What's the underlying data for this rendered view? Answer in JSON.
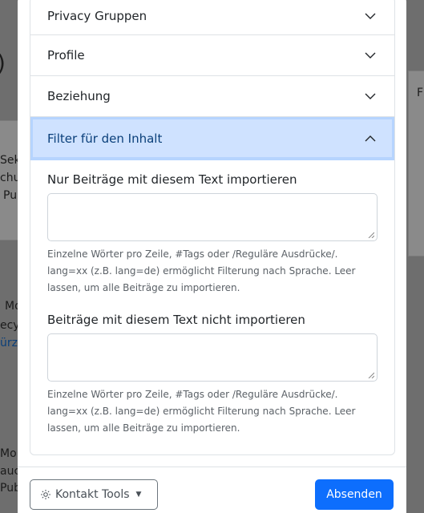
{
  "background": {
    "fragments": [
      "Sek",
      "chu",
      "Pub",
      "Mo",
      "ecy",
      "ürz",
      "Mo",
      "auc",
      "Pub",
      "F"
    ]
  },
  "accordion": {
    "items": [
      {
        "label": "Privacy Gruppen",
        "state": "collapsed"
      },
      {
        "label": "Profile",
        "state": "collapsed"
      },
      {
        "label": "Beziehung",
        "state": "collapsed"
      },
      {
        "label": "Filter für den Inhalt",
        "state": "expanded"
      }
    ]
  },
  "filter": {
    "include_label": "Nur Beiträge mit diesem Text importieren",
    "include_value": "",
    "include_help": "Einzelne Wörter pro Zeile, #Tags oder /Reguläre Ausdrücke/. lang=xx (z.B. lang=de) ermöglicht Filterung nach Sprache. Leer lassen, um alle Beiträge zu importieren.",
    "exclude_label": "Beiträge mit diesem Text nicht importieren",
    "exclude_value": "",
    "exclude_help": "Einzelne Wörter pro Zeile, #Tags oder /Reguläre Ausdrücke/. lang=xx (z.B. lang=de) ermöglicht Filterung nach Sprache. Leer lassen, um alle Beiträge zu importieren."
  },
  "footer": {
    "tools_label": "Kontakt Tools",
    "submit_label": "Absenden"
  },
  "colors": {
    "primary": "#0d6efd",
    "active_bg": "#cfe2ff",
    "overlay": "#6e6e6e"
  }
}
